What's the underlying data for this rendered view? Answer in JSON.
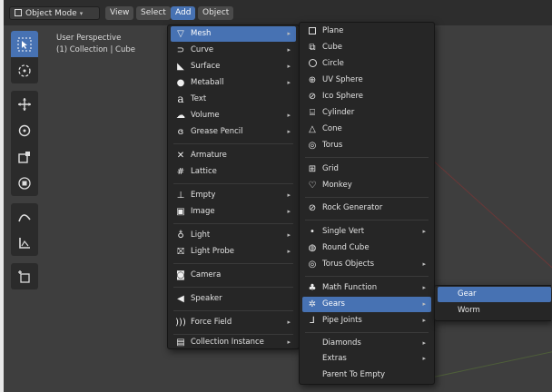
{
  "header": {
    "mode_label": "Object Mode",
    "menus": [
      {
        "label": "View"
      },
      {
        "label": "Select"
      },
      {
        "label": "Add"
      },
      {
        "label": "Object"
      }
    ]
  },
  "viewport_info": {
    "line1": "User Perspective",
    "line2": "(1) Collection | Cube"
  },
  "toolbar": {
    "tools": [
      {
        "name": "select-box-tool",
        "icon": "cursor-box-icon",
        "active": true
      },
      {
        "name": "cursor-tool",
        "icon": "3d-cursor-icon",
        "active": false
      },
      {
        "name": "move-tool",
        "icon": "move-arrows-icon",
        "active": false
      },
      {
        "name": "rotate-tool",
        "icon": "rotate-icon",
        "active": false
      },
      {
        "name": "scale-tool",
        "icon": "scale-icon",
        "active": false
      },
      {
        "name": "transform-tool",
        "icon": "transform-icon",
        "active": false
      },
      {
        "name": "annotate-tool",
        "icon": "annotate-icon",
        "active": false
      },
      {
        "name": "measure-tool",
        "icon": "measure-icon",
        "active": false
      },
      {
        "name": "add-cube-tool",
        "icon": "add-cube-icon",
        "active": false
      }
    ]
  },
  "add_menu": {
    "items": [
      {
        "label": "Mesh",
        "icon": "mesh-icon",
        "submenu": true,
        "highlighted": true
      },
      {
        "label": "Curve",
        "icon": "curve-icon",
        "submenu": true
      },
      {
        "label": "Surface",
        "icon": "surface-icon",
        "submenu": true
      },
      {
        "label": "Metaball",
        "icon": "metaball-icon",
        "submenu": true
      },
      {
        "label": "Text",
        "icon": "text-icon",
        "submenu": false
      },
      {
        "label": "Volume",
        "icon": "volume-icon",
        "submenu": true
      },
      {
        "label": "Grease Pencil",
        "icon": "grease-pencil-icon",
        "submenu": true
      },
      {
        "label": "Armature",
        "icon": "armature-icon",
        "submenu": false
      },
      {
        "label": "Lattice",
        "icon": "lattice-icon",
        "submenu": false
      },
      {
        "label": "Empty",
        "icon": "empty-icon",
        "submenu": true
      },
      {
        "label": "Image",
        "icon": "image-icon",
        "submenu": true
      },
      {
        "label": "Light",
        "icon": "light-icon",
        "submenu": true
      },
      {
        "label": "Light Probe",
        "icon": "light-probe-icon",
        "submenu": true
      },
      {
        "label": "Camera",
        "icon": "camera-icon",
        "submenu": false
      },
      {
        "label": "Speaker",
        "icon": "speaker-icon",
        "submenu": false
      },
      {
        "label": "Force Field",
        "icon": "force-field-icon",
        "submenu": true
      },
      {
        "label": "Collection Instance",
        "icon": "collection-instance-icon",
        "submenu": true
      }
    ]
  },
  "mesh_menu": {
    "items": [
      {
        "label": "Plane",
        "icon": "plane-icon",
        "submenu": false
      },
      {
        "label": "Cube",
        "icon": "cube-icon",
        "submenu": false
      },
      {
        "label": "Circle",
        "icon": "circle-icon",
        "submenu": false
      },
      {
        "label": "UV Sphere",
        "icon": "uv-sphere-icon",
        "submenu": false
      },
      {
        "label": "Ico Sphere",
        "icon": "ico-sphere-icon",
        "submenu": false
      },
      {
        "label": "Cylinder",
        "icon": "cylinder-icon",
        "submenu": false
      },
      {
        "label": "Cone",
        "icon": "cone-icon",
        "submenu": false
      },
      {
        "label": "Torus",
        "icon": "torus-icon",
        "submenu": false
      },
      {
        "label": "Grid",
        "icon": "grid-icon",
        "submenu": false
      },
      {
        "label": "Monkey",
        "icon": "monkey-icon",
        "submenu": false
      },
      {
        "label": "Rock Generator",
        "icon": "rock-generator-icon",
        "submenu": false
      },
      {
        "label": "Single Vert",
        "icon": "single-vert-icon",
        "submenu": true
      },
      {
        "label": "Round Cube",
        "icon": "round-cube-icon",
        "submenu": false
      },
      {
        "label": "Torus Objects",
        "icon": "torus-objects-icon",
        "submenu": true
      },
      {
        "label": "Math Function",
        "icon": "math-function-icon",
        "submenu": true
      },
      {
        "label": "Gears",
        "icon": "gears-icon",
        "submenu": true,
        "highlighted": true
      },
      {
        "label": "Pipe Joints",
        "icon": "pipe-joints-icon",
        "submenu": true
      },
      {
        "label": "Diamonds",
        "icon": "",
        "submenu": true
      },
      {
        "label": "Extras",
        "icon": "",
        "submenu": true
      },
      {
        "label": "Parent To Empty",
        "icon": "",
        "submenu": false
      }
    ]
  },
  "gears_menu": {
    "items": [
      {
        "label": "Gear",
        "highlighted": true
      },
      {
        "label": "Worm",
        "highlighted": false
      }
    ]
  }
}
